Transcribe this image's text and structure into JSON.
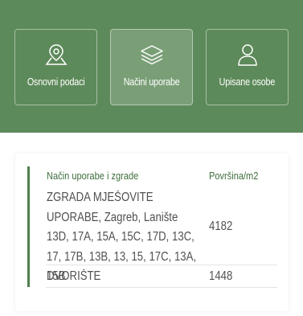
{
  "nav": {
    "tiles": [
      {
        "label": "Osnovni podaci",
        "icon": "map-pin-icon"
      },
      {
        "label": "Načini uporabe",
        "icon": "layers-icon"
      },
      {
        "label": "Upisane osobe",
        "icon": "person-icon"
      }
    ],
    "active_index": 1,
    "colors": {
      "band": "#5d8a5a",
      "accent": "#4f7f4d"
    }
  },
  "table": {
    "headers": {
      "usage": "Način uporabe i zgrade",
      "area": "Površina/m2"
    },
    "rows": [
      {
        "usage": "ZGRADA MJEŠOVITE UPORABE, Zagreb, Lanište 13D, 17A, 15A, 15C, 17D, 13C, 17, 17B, 13B, 13, 15, 17C, 13A, 15B",
        "area": "4182"
      },
      {
        "usage": "DVORIŠTE",
        "area": "1448"
      }
    ]
  }
}
